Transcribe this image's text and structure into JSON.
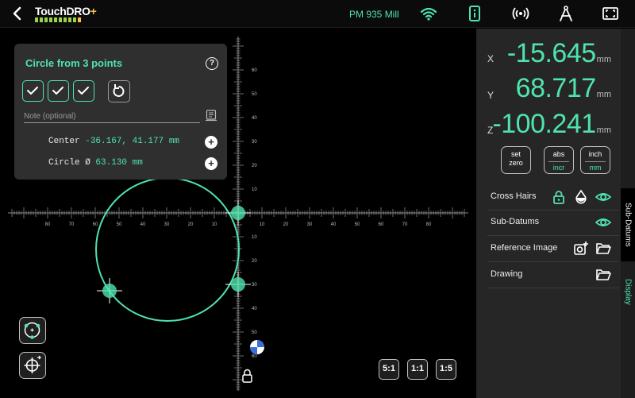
{
  "app": {
    "logo_text": "TouchDRO",
    "logo_plus": "+",
    "machine_name": "PM 935 Mill"
  },
  "popup": {
    "title": "Circle from 3 points",
    "help_label": "?",
    "note_placeholder": "Note (optional)",
    "center_label": "Center",
    "center_value": "-36.167, 41.177 mm",
    "circle_label": "Circle Ø",
    "circle_value": "63.130 mm",
    "add_label": "+"
  },
  "zoom": {
    "z1": "5:1",
    "z2": "1:1",
    "z3": "1:5"
  },
  "dro": {
    "x_label": "X",
    "x_value": "-15.645",
    "y_label": "Y",
    "y_value": "68.717",
    "z_label": "Z",
    "z_value": "-100.241",
    "unit": "mm"
  },
  "panel_buttons": {
    "set_zero_line1": "set",
    "set_zero_line2": "zero",
    "abs_label": "abs",
    "incr_label": "incr",
    "inch_label": "inch",
    "mm_label": "mm"
  },
  "options": {
    "cross_hairs": "Cross Hairs",
    "sub_datums": "Sub-Datums",
    "reference_image": "Reference Image",
    "drawing": "Drawing"
  },
  "tabs": {
    "sub_datums": "Sub-Datums",
    "display": "Display"
  },
  "scale": {
    "h_neg": [
      "80",
      "70",
      "60",
      "50",
      "40",
      "30",
      "20",
      "10"
    ],
    "h_pos": [
      "10",
      "20",
      "30",
      "40",
      "50",
      "60",
      "70",
      "80"
    ],
    "v_up": [
      "60",
      "50",
      "40",
      "30",
      "20",
      "10"
    ],
    "v_down": [
      "10",
      "20",
      "30",
      "40",
      "50",
      "60"
    ]
  },
  "colors": {
    "accent": "#4fe3ad",
    "background": "#000000",
    "panel": "#262626",
    "popup": "#2f2f2f"
  }
}
